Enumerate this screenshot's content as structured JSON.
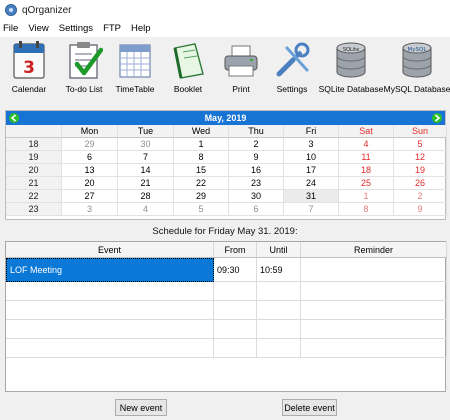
{
  "window": {
    "title": "qOrganizer"
  },
  "menu": [
    "File",
    "View",
    "Settings",
    "FTP",
    "Help"
  ],
  "toolbar": [
    {
      "label": "Calendar",
      "icon": "calendar-icon"
    },
    {
      "label": "To-do List",
      "icon": "todo-list-icon"
    },
    {
      "label": "TimeTable",
      "icon": "timetable-icon"
    },
    {
      "label": "Booklet",
      "icon": "booklet-icon"
    },
    {
      "label": "Print",
      "icon": "printer-icon"
    },
    {
      "label": "Settings",
      "icon": "settings-icon"
    },
    {
      "label": "SQLite Database",
      "icon": "sqlite-database-icon",
      "db_text": "SQLite"
    },
    {
      "label": "MySQL Database",
      "icon": "mysql-database-icon",
      "db_text": "MySQL"
    }
  ],
  "calendar": {
    "month_label": "May,  2019",
    "weekdays": [
      "Mon",
      "Tue",
      "Wed",
      "Thu",
      "Fri",
      "Sat",
      "Sun"
    ],
    "weeks": [
      {
        "num": "18",
        "days": [
          "29",
          "30",
          "1",
          "2",
          "3",
          "4",
          "5"
        ]
      },
      {
        "num": "19",
        "days": [
          "6",
          "7",
          "8",
          "9",
          "10",
          "11",
          "12"
        ]
      },
      {
        "num": "20",
        "days": [
          "13",
          "14",
          "15",
          "16",
          "17",
          "18",
          "19"
        ]
      },
      {
        "num": "21",
        "days": [
          "20",
          "21",
          "22",
          "23",
          "24",
          "25",
          "26"
        ]
      },
      {
        "num": "22",
        "days": [
          "27",
          "28",
          "29",
          "30",
          "31",
          "1",
          "2"
        ]
      },
      {
        "num": "23",
        "days": [
          "3",
          "4",
          "5",
          "6",
          "7",
          "8",
          "9"
        ]
      }
    ],
    "selected_day": "31",
    "colors": {
      "header": "#1773d4",
      "weekend": "#e52b2b",
      "arrow": "#2bbf2b"
    }
  },
  "schedule": {
    "title": "Schedule for Friday May 31. 2019:",
    "columns": [
      "Event",
      "From",
      "Until",
      "Reminder"
    ],
    "rows": [
      [
        "LOF Meeting",
        "09:30",
        "10:59",
        ""
      ],
      [
        "",
        "",
        "",
        ""
      ],
      [
        "",
        "",
        "",
        ""
      ],
      [
        "",
        "",
        "",
        ""
      ],
      [
        "",
        "",
        "",
        ""
      ]
    ],
    "highlight_color": "#0a78d7"
  },
  "buttons": {
    "new_event": "New event",
    "delete_event": "Delete event"
  }
}
